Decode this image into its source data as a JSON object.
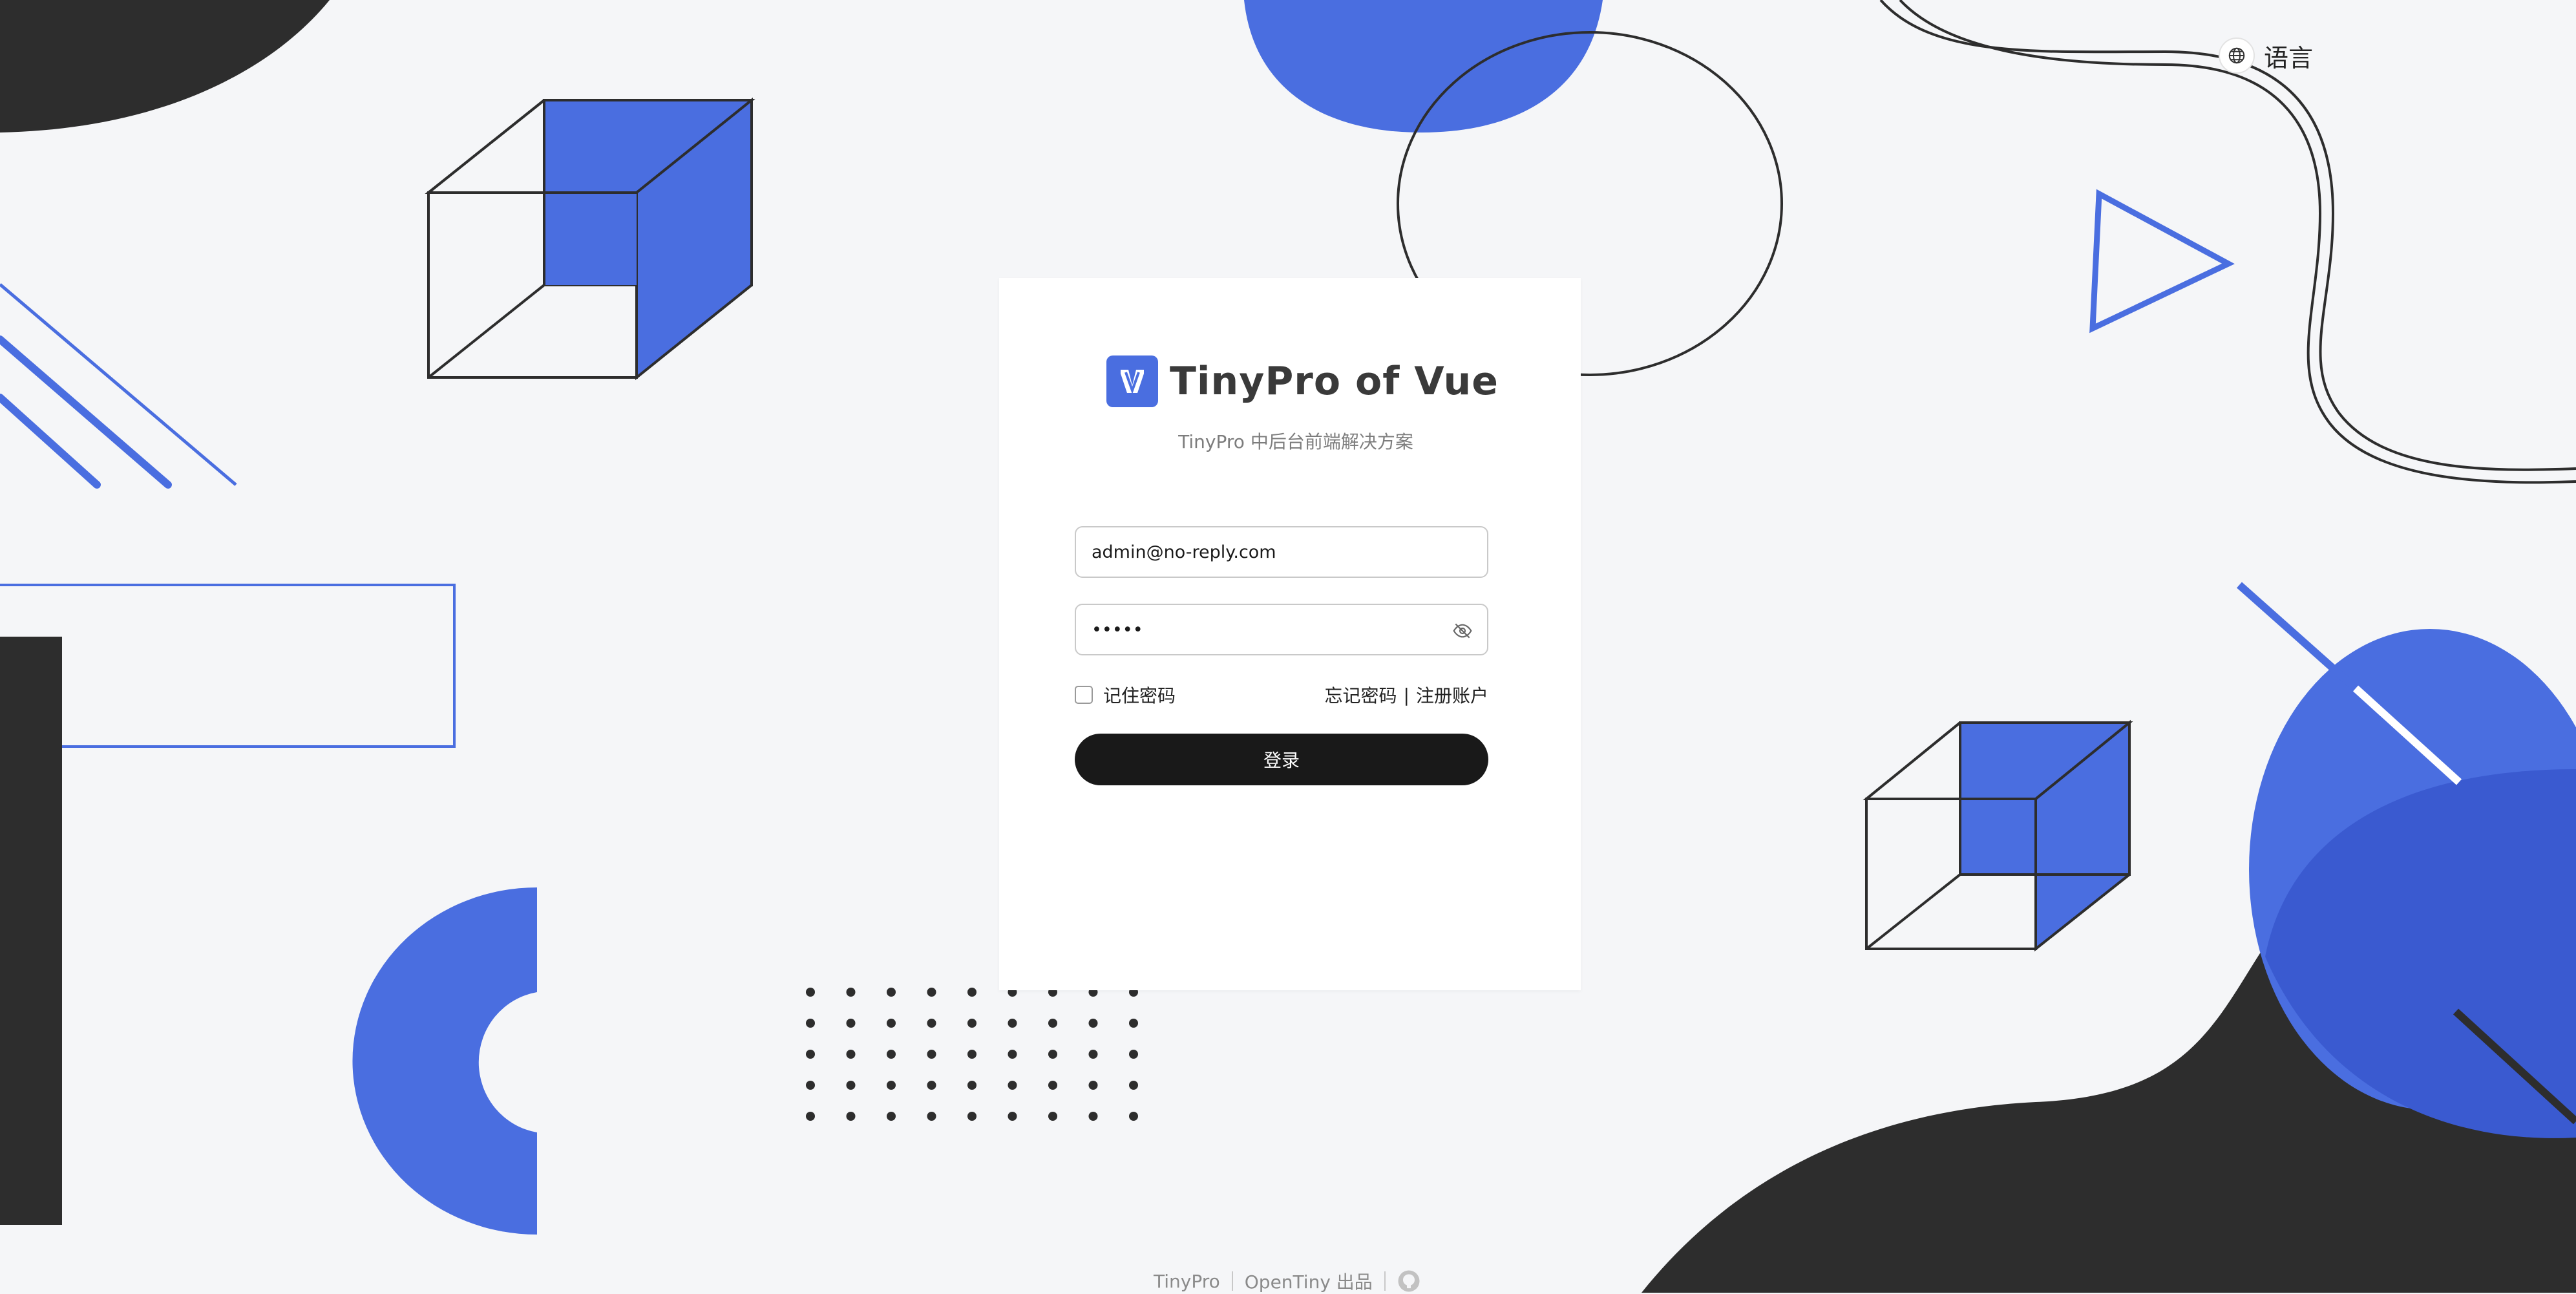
{
  "language_switch": {
    "label": "语言",
    "icon": "globe-icon"
  },
  "login_card": {
    "logo_icon": "tinypro-logo-icon",
    "title": "TinyPro of Vue",
    "subtitle": "TinyPro 中后台前端解决方案",
    "username": {
      "value": "admin@no-reply.com"
    },
    "password": {
      "value": "admin",
      "visibility_icon": "eye-off-icon"
    },
    "remember_label": "记住密码",
    "remember_checked": false,
    "forgot_label": "忘记密码",
    "link_separator": "|",
    "register_label": "注册账户",
    "login_button": "登录"
  },
  "footer": {
    "product": "TinyPro",
    "credit": "OpenTiny 出品",
    "github_icon": "github-icon"
  },
  "colors": {
    "accent_blue": "#4a6ee0",
    "dark": "#2d2d2d",
    "background": "#f5f6f8",
    "button": "#191919"
  }
}
